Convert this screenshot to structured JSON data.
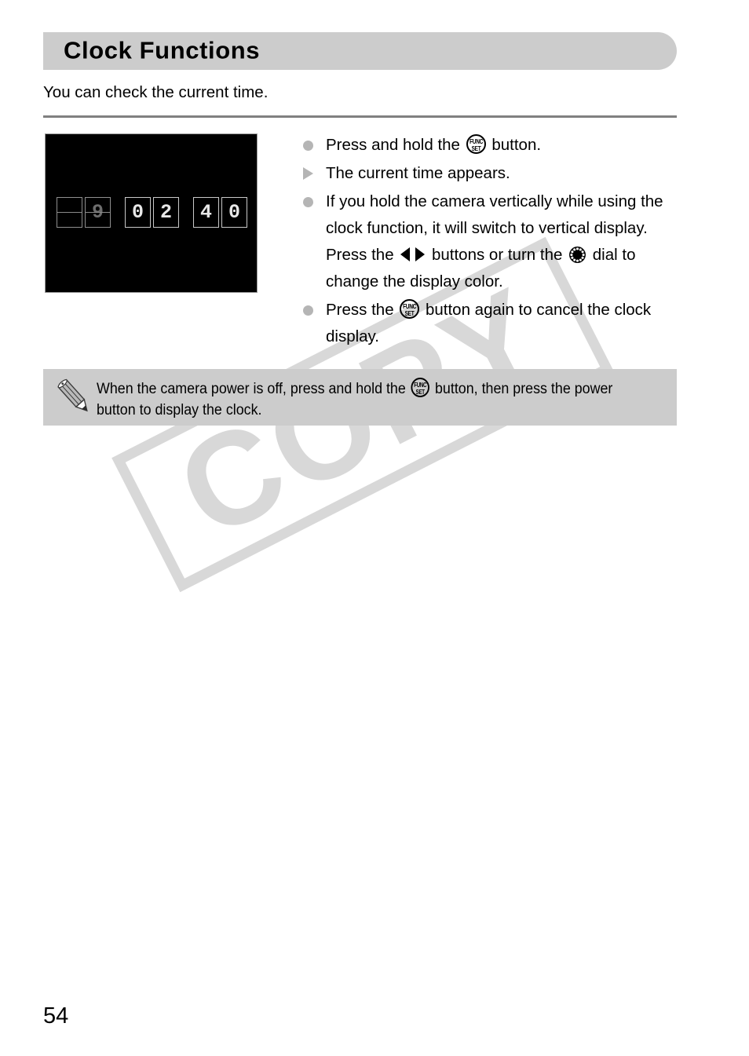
{
  "page": {
    "number": "54",
    "watermark": "COPY",
    "watermark_color": "#d8d8d8",
    "banner_color": "#cccccc",
    "rule_color": "#808080",
    "bullet_color": "#b5b5b5"
  },
  "header": {
    "title": "Clock Functions"
  },
  "intro": {
    "text": "You can check the current time."
  },
  "figure": {
    "alt": "camera-lcd-clock-display",
    "background": "#000000",
    "digits": [
      {
        "value": "",
        "state": "flipping-blank"
      },
      {
        "value": "9",
        "state": "flipping"
      },
      {
        "value": "0",
        "state": "static"
      },
      {
        "value": "2",
        "state": "static"
      },
      {
        "value": "4",
        "state": "static"
      },
      {
        "value": "0",
        "state": "static"
      }
    ],
    "time_reading": "09:02:40"
  },
  "instructions": [
    {
      "marker": "bullet",
      "parts": [
        {
          "type": "text",
          "value": "Press and hold the "
        },
        {
          "type": "icon",
          "value": "func-set-button-icon"
        },
        {
          "type": "text",
          "value": " button."
        }
      ],
      "plain": "Press and hold the FUNC/SET button."
    },
    {
      "marker": "triangle",
      "parts": [
        {
          "type": "text",
          "value": "The current time appears."
        }
      ],
      "plain": "The current time appears."
    },
    {
      "marker": "bullet",
      "parts": [
        {
          "type": "text",
          "value": "If you hold the camera vertically while using the clock function, it will switch to vertical display. Press the "
        },
        {
          "type": "icon",
          "value": "left-right-buttons-icon"
        },
        {
          "type": "text",
          "value": " buttons or turn the "
        },
        {
          "type": "icon",
          "value": "control-dial-icon"
        },
        {
          "type": "text",
          "value": " dial to change the display color."
        }
      ],
      "plain": "If you hold the camera vertically while using the clock function, it will switch to vertical display. Press the left/right buttons or turn the control dial to change the display color."
    },
    {
      "marker": "bullet",
      "parts": [
        {
          "type": "text",
          "value": "Press the "
        },
        {
          "type": "icon",
          "value": "func-set-button-icon"
        },
        {
          "type": "text",
          "value": " button again to cancel the clock display."
        }
      ],
      "plain": "Press the FUNC/SET button again to cancel the clock display."
    }
  ],
  "instruction_text": {
    "item1_a": "Press and hold the ",
    "item1_b": " button.",
    "item2": "The current time appears.",
    "item3_a": "If you hold the camera vertically while using the clock function, it will switch to vertical display. Press the ",
    "item3_b": " buttons or turn the ",
    "item3_c": " dial to change the display color.",
    "item4_a": "Press the ",
    "item4_b": " button again to cancel the clock display."
  },
  "note": {
    "icon": "pencil-icon",
    "text_a": "When the camera power is off, press and hold the ",
    "text_b": " button, then press the power button to display the clock.",
    "plain": "When the camera power is off, press and hold the FUNC/SET button, then press the power button to display the clock."
  },
  "icons": {
    "func_set_line1": "FUNC",
    "func_set_line2": "SET"
  }
}
